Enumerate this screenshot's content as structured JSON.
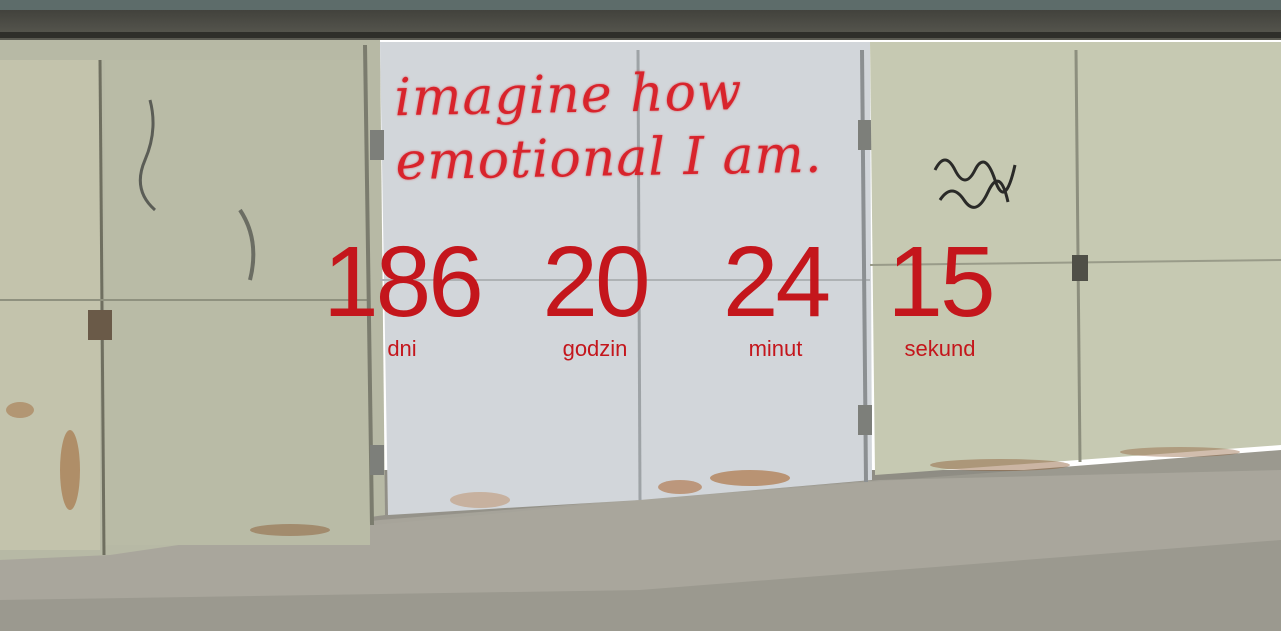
{
  "graffiti": {
    "line1": "imagine how",
    "line2": "emotional I am."
  },
  "countdown": {
    "days": {
      "value": "186",
      "label": "dni"
    },
    "hours": {
      "value": "20",
      "label": "godzin"
    },
    "minutes": {
      "value": "24",
      "label": "minut"
    },
    "seconds": {
      "value": "15",
      "label": "sekund"
    }
  },
  "colors": {
    "accent": "#c4161c",
    "graffiti": "#d8242c"
  }
}
